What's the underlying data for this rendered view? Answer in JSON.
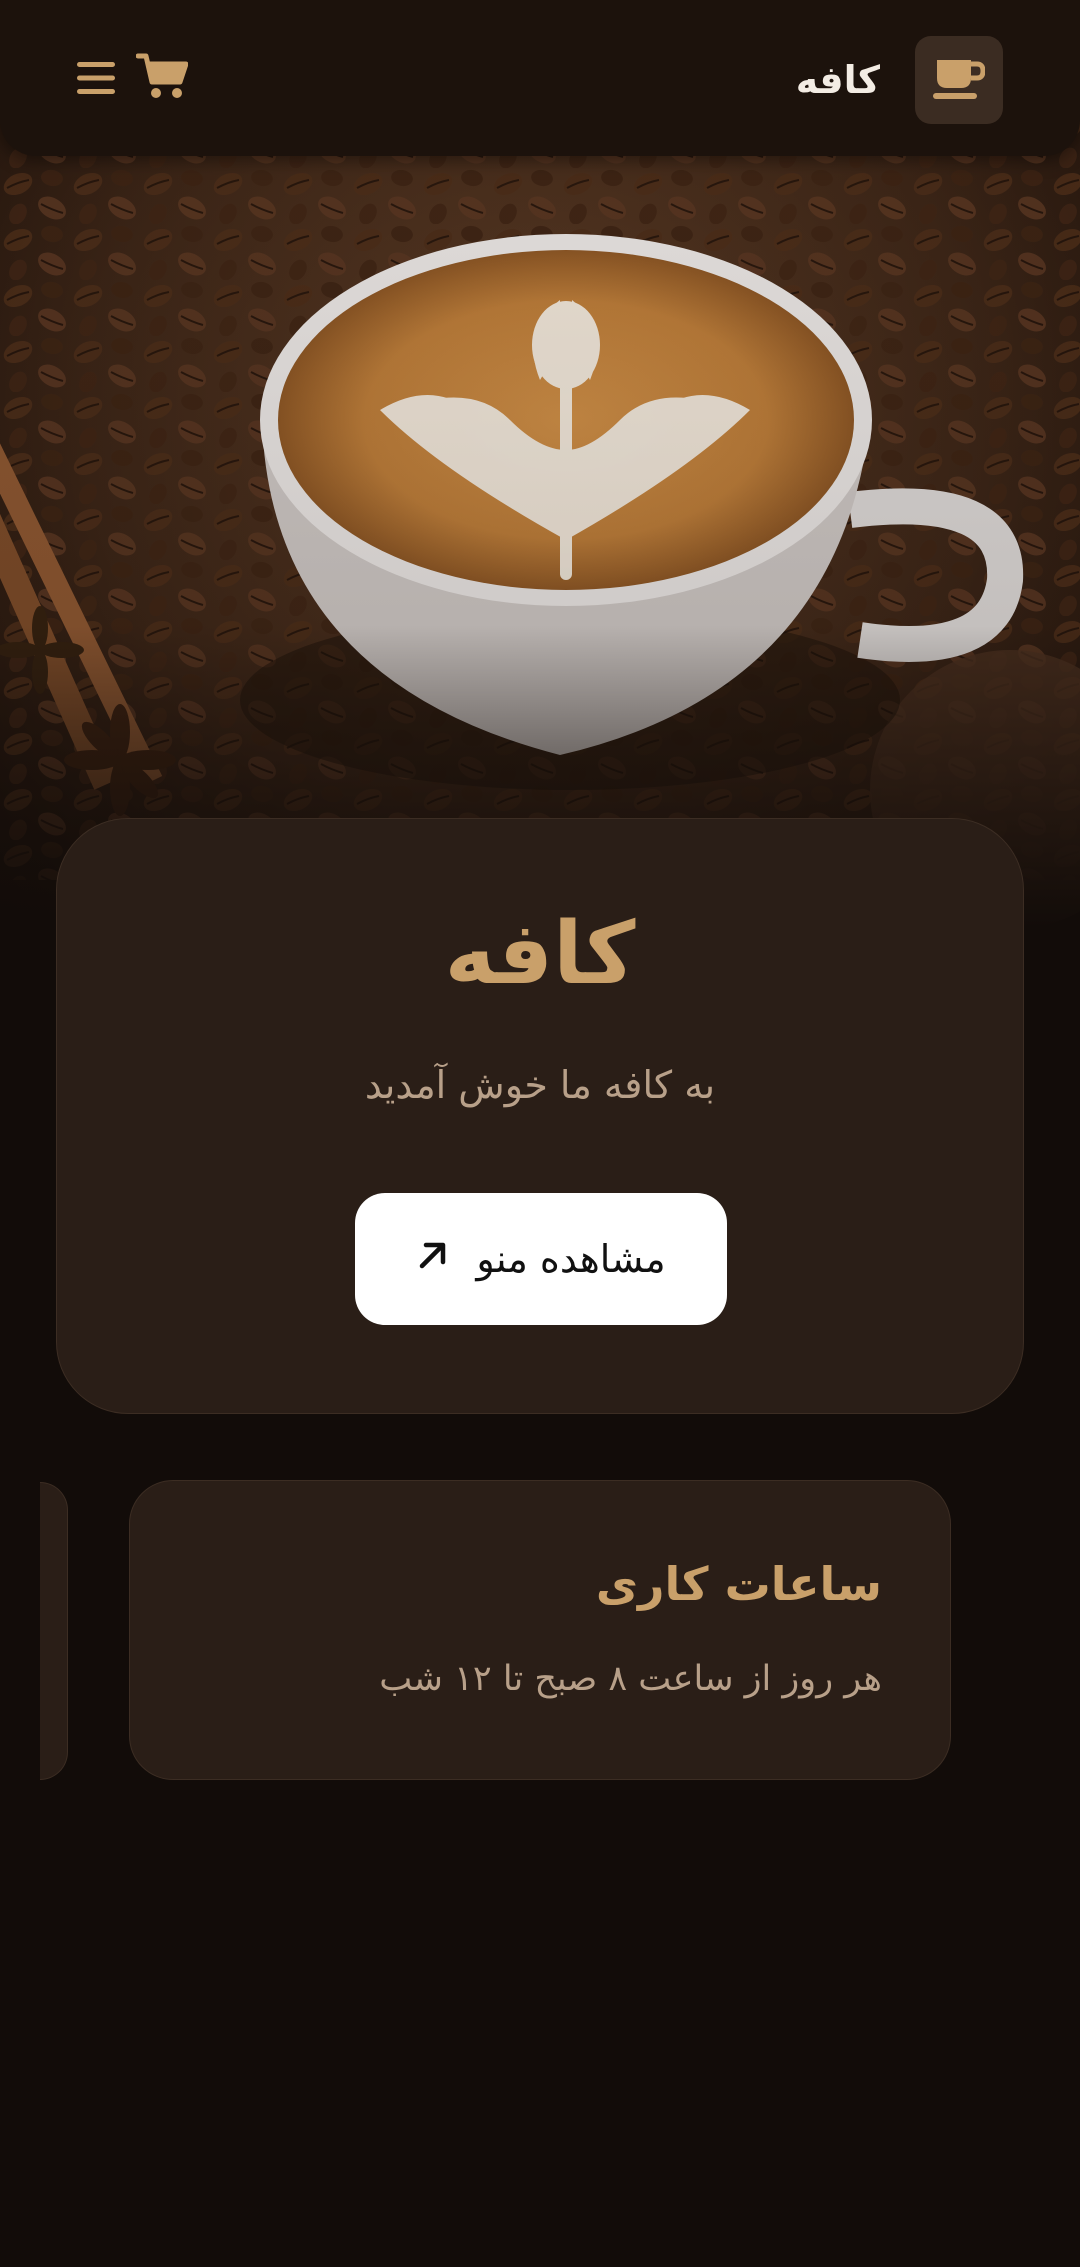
{
  "header": {
    "brand_name": "کافه",
    "icons": {
      "logo": "coffee-cup-icon",
      "cart": "shopping-cart-icon",
      "menu": "hamburger-menu-icon"
    }
  },
  "hero": {
    "title": "کافه",
    "subtitle": "به کافه ما خوش آمدید",
    "cta_label": "مشاهده منو",
    "cta_icon": "arrow-up-right-icon"
  },
  "hours_card": {
    "title": "ساعات کاری",
    "text": "هر روز از ساعت ۸ صبح تا ۱۲ شب"
  },
  "colors": {
    "background": "#120c09",
    "header": "#1c120c",
    "card": "#2a1e17",
    "accent": "#c9a06a",
    "muted_text": "#b8a089"
  }
}
